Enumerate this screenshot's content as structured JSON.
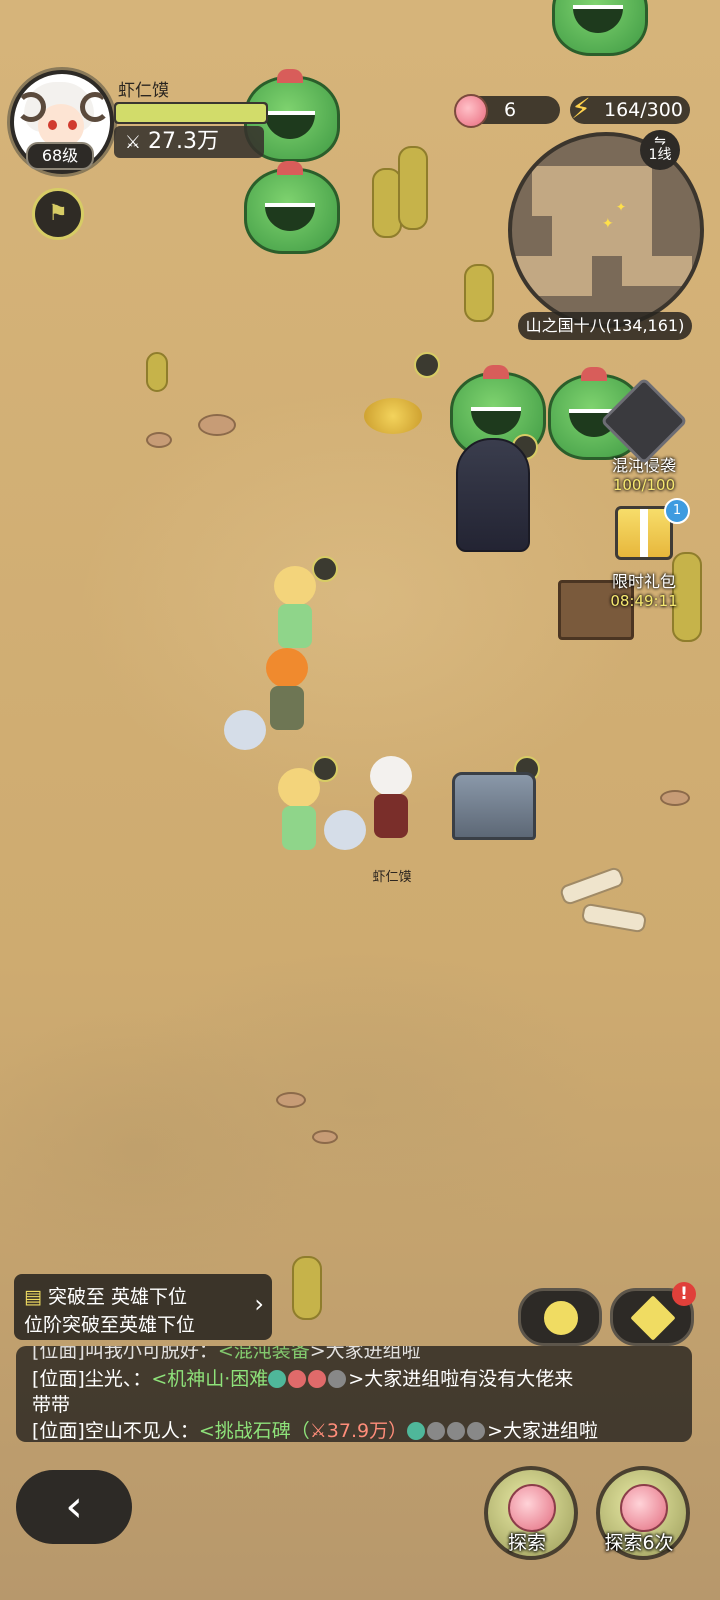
{
  "player": {
    "name": "虾仁馍",
    "level": "68级",
    "power": "27.3万",
    "hp_fraction": 1.0
  },
  "resources": {
    "apples": "6",
    "energy": "164/300"
  },
  "minimap": {
    "line": "1线",
    "location": "山之国十八(134,161)"
  },
  "events": {
    "chaos_name": "混沌侵袭",
    "chaos_count": "100/100",
    "gift_name": "限时礼包",
    "gift_timer": "08:49:11",
    "gift_badge": "1"
  },
  "map_labels": {
    "player_tag": "虾仁馍"
  },
  "quest": {
    "line1": "突破至 英雄下位",
    "line2": "位阶突破至英雄下位",
    "arrow": "›"
  },
  "corner_badge": "!",
  "chat": {
    "line0_prefix": "[位面]叫我小可脱好：",
    "line0_link": "<混沌装备",
    "line0_tail": ">大家进组啦",
    "line1_prefix": "[位面]尘光、：",
    "line1_link": "<机神山·困难",
    "line1_tail": ">大家进组啦有没有大佬来",
    "line2": "带带",
    "line3_prefix": "[位面]空山不见人：",
    "line3_link": "<挑战石碑（",
    "line3_power": "37.9万）",
    "line3_tail": ">大家进组啦"
  },
  "bottom": {
    "back": "‹",
    "explore": "探索",
    "explore6": "探索6次"
  },
  "colors": {
    "sand": "#cfad73",
    "panel": "#2d2a26",
    "accent_yellow": "#f0dc62",
    "link_green": "#8ee27a"
  }
}
